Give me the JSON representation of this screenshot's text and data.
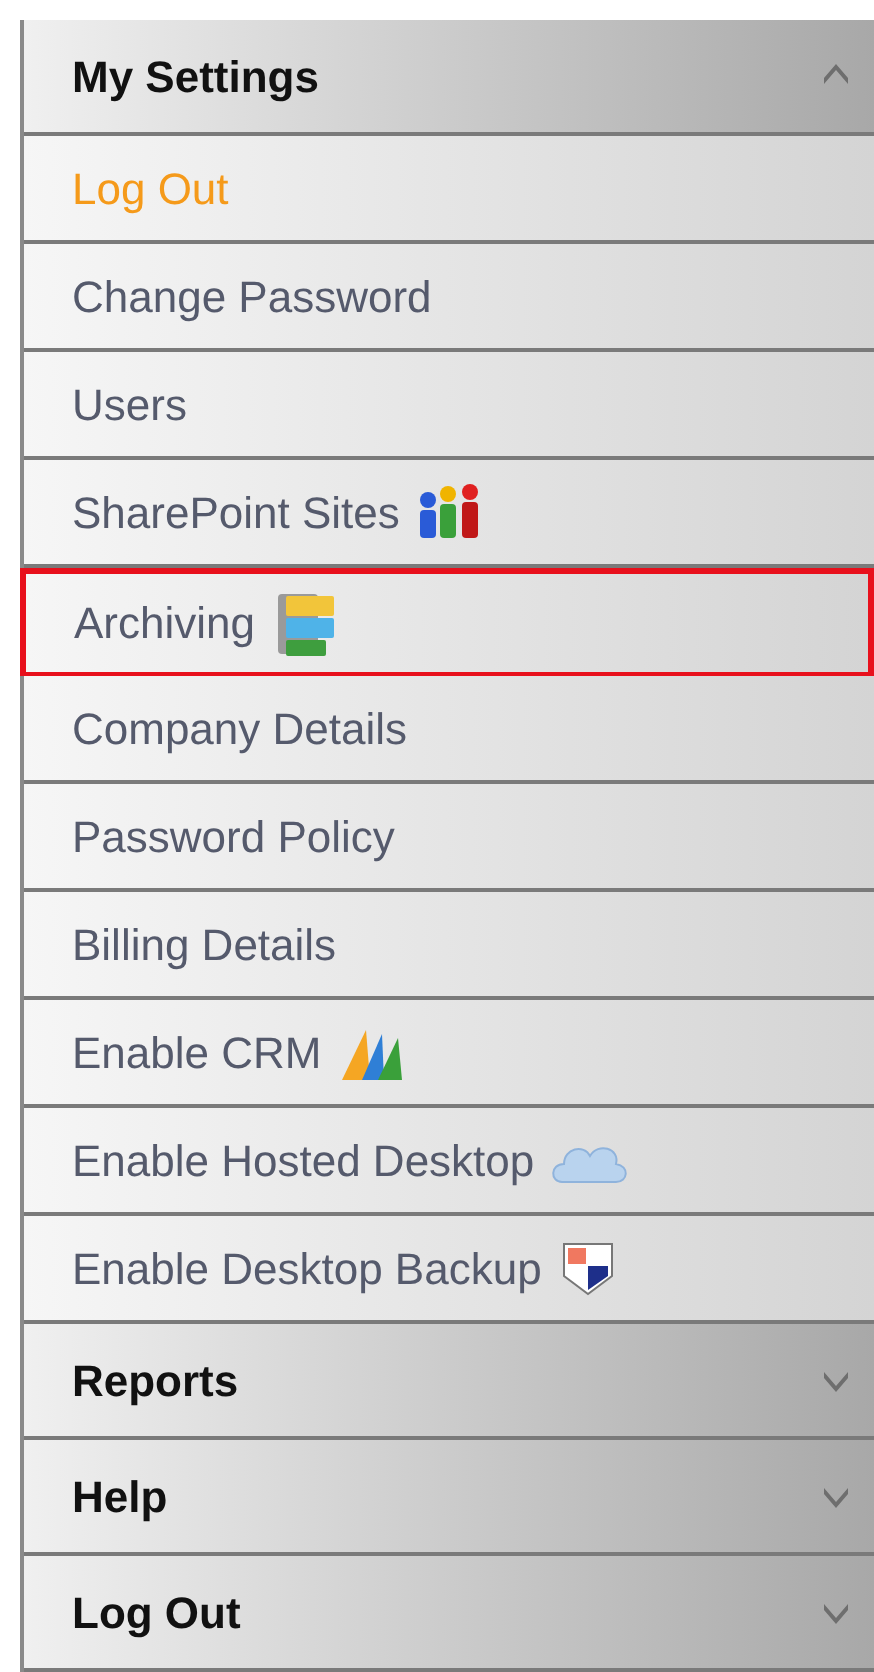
{
  "sections": [
    {
      "title": "My Settings",
      "expanded": true,
      "items": [
        {
          "label": "Log Out",
          "selected": true,
          "highlighted": false,
          "kind": "plain"
        },
        {
          "label": "Change Password",
          "selected": false,
          "highlighted": false,
          "kind": "plain"
        },
        {
          "label": "Users",
          "selected": false,
          "highlighted": false,
          "kind": "plain"
        },
        {
          "label": "SharePoint Sites",
          "selected": false,
          "highlighted": false,
          "kind": "people"
        },
        {
          "label": "Archiving",
          "selected": false,
          "highlighted": true,
          "kind": "cabinet"
        },
        {
          "label": "Company Details",
          "selected": false,
          "highlighted": false,
          "kind": "plain"
        },
        {
          "label": "Password Policy",
          "selected": false,
          "highlighted": false,
          "kind": "plain"
        },
        {
          "label": "Billing Details",
          "selected": false,
          "highlighted": false,
          "kind": "plain"
        },
        {
          "label": "Enable CRM",
          "selected": false,
          "highlighted": false,
          "kind": "bars"
        },
        {
          "label": "Enable Hosted Desktop",
          "selected": false,
          "highlighted": false,
          "kind": "cloud"
        },
        {
          "label": "Enable Desktop Backup",
          "selected": false,
          "highlighted": false,
          "kind": "shield"
        }
      ]
    },
    {
      "title": "Reports",
      "expanded": false
    },
    {
      "title": "Help",
      "expanded": false
    },
    {
      "title": "Log Out",
      "expanded": false
    }
  ]
}
